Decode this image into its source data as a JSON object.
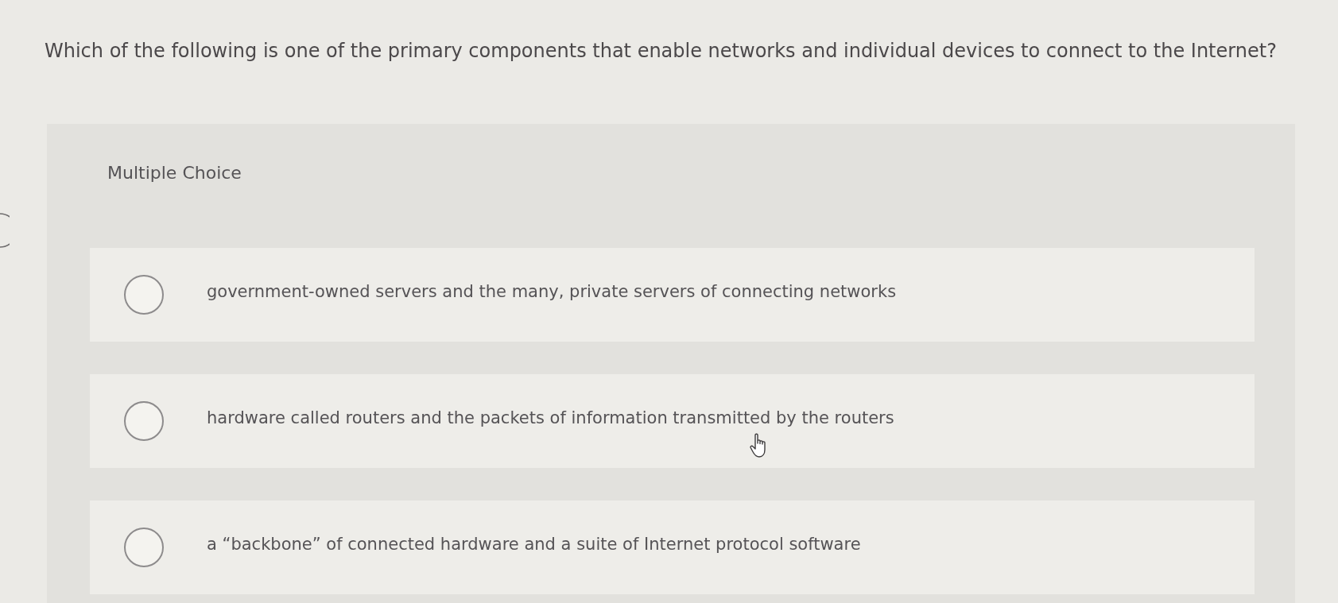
{
  "question": {
    "text": "Which of the following is one of the primary components that enable networks and individual devices to connect to the Internet?"
  },
  "answer_area": {
    "label": "Multiple Choice",
    "options": [
      {
        "text": "government-owned servers and the many, private servers of connecting networks",
        "selected": false
      },
      {
        "text": "hardware called routers and the packets of information transmitted by the routers",
        "selected": false
      },
      {
        "text": "a “backbone” of connected hardware and a suite of Internet protocol software",
        "selected": false
      }
    ]
  }
}
